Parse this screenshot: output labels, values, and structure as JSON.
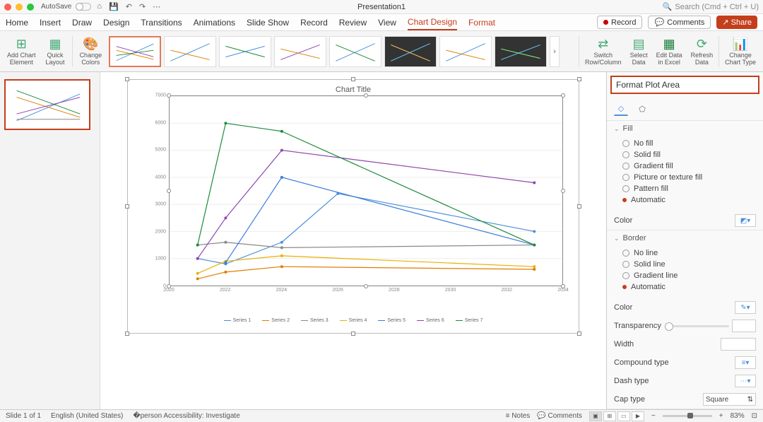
{
  "titlebar": {
    "autosave": "AutoSave",
    "presentation": "Presentation1",
    "search_placeholder": "Search (Cmd + Ctrl + U)"
  },
  "ribbontabs": {
    "home": "Home",
    "insert": "Insert",
    "draw": "Draw",
    "design": "Design",
    "transitions": "Transitions",
    "animations": "Animations",
    "slideshow": "Slide Show",
    "record_tab": "Record",
    "review": "Review",
    "view": "View",
    "chartdesign": "Chart Design",
    "format": "Format",
    "record_btn": "Record",
    "comments": "Comments",
    "share": "Share"
  },
  "ribbon": {
    "add_chart_element": "Add Chart\nElement",
    "quick_layout": "Quick\nLayout",
    "change_colors": "Change\nColors",
    "switch": "Switch\nRow/Column",
    "select_data": "Select\nData",
    "edit_data": "Edit Data\nin Excel",
    "refresh": "Refresh\nData",
    "change_type": "Change\nChart Type"
  },
  "formatpane": {
    "title": "Format Plot Area",
    "fill": "Fill",
    "fill_opts": {
      "no": "No fill",
      "solid": "Solid fill",
      "grad": "Gradient fill",
      "pic": "Picture or texture fill",
      "pat": "Pattern fill",
      "auto": "Automatic"
    },
    "color": "Color",
    "border": "Border",
    "border_opts": {
      "no": "No line",
      "solid": "Solid line",
      "grad": "Gradient line",
      "auto": "Automatic"
    },
    "transparency": "Transparency",
    "width": "Width",
    "compound": "Compound type",
    "dash": "Dash type",
    "cap": "Cap type",
    "cap_val": "Square"
  },
  "status": {
    "slide": "Slide 1 of 1",
    "lang": "English (United States)",
    "access": "Accessibility: Investigate",
    "notes": "Notes",
    "comments": "Comments",
    "zoom": "83%"
  },
  "chart_data": {
    "type": "line",
    "title": "Chart Title",
    "xlabel": "",
    "ylabel": "",
    "x": [
      2020,
      2022,
      2024,
      2026,
      2028,
      2030,
      2032,
      2034
    ],
    "ylim": [
      0,
      7000
    ],
    "yticks": [
      0,
      1000,
      2000,
      3000,
      4000,
      5000,
      6000,
      7000
    ],
    "series": [
      {
        "name": "Series 1",
        "color": "#4a90d9",
        "x": [
          2021,
          2022,
          2024,
          2026,
          2028,
          2030,
          2032,
          2033
        ],
        "values": [
          1000,
          800,
          1600,
          3400,
          null,
          null,
          null,
          2000
        ]
      },
      {
        "name": "Series 2",
        "color": "#e07b00",
        "x": [
          2021,
          2022,
          2024,
          2033
        ],
        "values": [
          250,
          500,
          700,
          600
        ]
      },
      {
        "name": "Series 3",
        "color": "#888888",
        "x": [
          2021,
          2022,
          2024,
          2033
        ],
        "values": [
          1500,
          1600,
          1400,
          1500
        ]
      },
      {
        "name": "Series 4",
        "color": "#e8b000",
        "x": [
          2021,
          2022,
          2024,
          2033
        ],
        "values": [
          450,
          900,
          1100,
          700
        ]
      },
      {
        "name": "Series 5",
        "color": "#3a7ad9",
        "x": [
          2022,
          2024,
          2033
        ],
        "values": [
          850,
          4000,
          1500
        ]
      },
      {
        "name": "Series 6",
        "color": "#8e44ad",
        "x": [
          2021,
          2022,
          2024,
          2033
        ],
        "values": [
          1000,
          2500,
          5000,
          3800
        ]
      },
      {
        "name": "Series 7",
        "color": "#1b8a3a",
        "x": [
          2021,
          2022,
          2024,
          2033
        ],
        "values": [
          1500,
          6000,
          5700,
          1500
        ]
      }
    ],
    "legend_position": "bottom"
  }
}
